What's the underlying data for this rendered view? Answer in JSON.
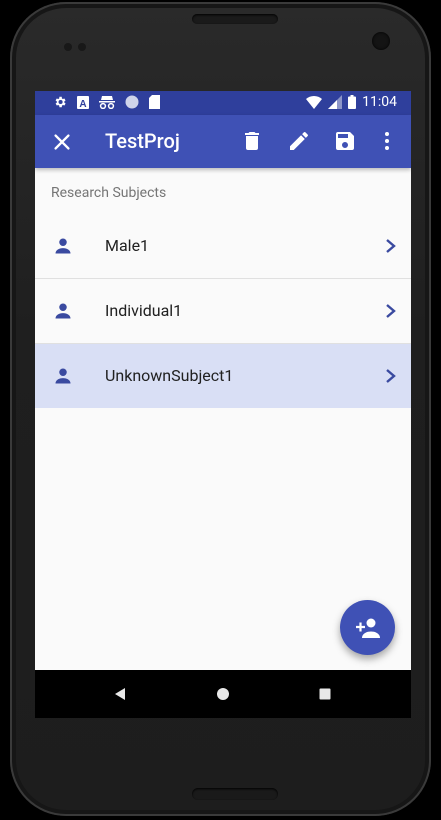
{
  "status_bar": {
    "time": "11:04",
    "left_icons": [
      "settings-icon",
      "a-icon",
      "incognito-icon",
      "circle-icon",
      "sd-card-icon"
    ],
    "right_icons": [
      "wifi-icon",
      "signal-icon",
      "battery-icon"
    ]
  },
  "app_bar": {
    "title": "TestProj",
    "actions": [
      "delete-icon",
      "edit-icon",
      "save-icon",
      "more-vert-icon"
    ]
  },
  "section": {
    "label": "Research Subjects"
  },
  "subjects": [
    {
      "name": "Male1",
      "selected": false
    },
    {
      "name": "Individual1",
      "selected": false
    },
    {
      "name": "UnknownSubject1",
      "selected": true
    }
  ],
  "fab": {
    "icon": "add-person-icon"
  },
  "colors": {
    "primary": "#3f51b5",
    "primary_dark": "#2f3f9c",
    "selected_row": "#d9dff5",
    "icon_indigo": "#3a4aa0"
  }
}
